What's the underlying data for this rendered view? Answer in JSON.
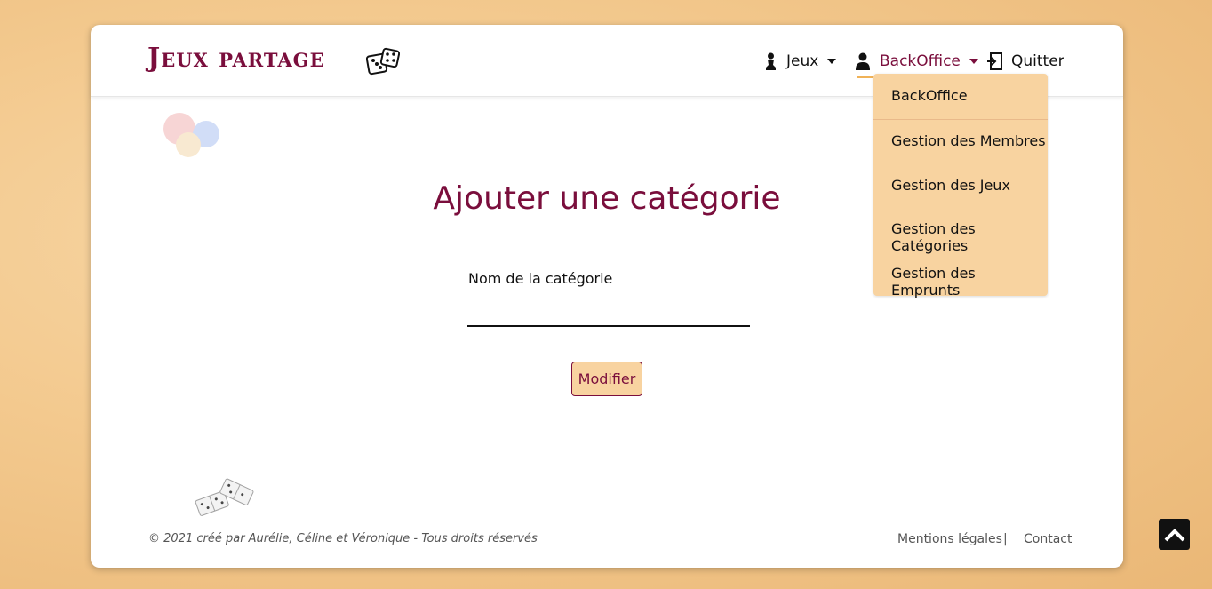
{
  "brand": {
    "name": "Jeux partage"
  },
  "nav": {
    "jeux_label": "Jeux",
    "backoffice_label": "BackOffice",
    "quit_label": "Quitter"
  },
  "dropdown": {
    "items": [
      {
        "label": "BackOffice"
      },
      {
        "label": "Gestion des Membres"
      },
      {
        "label": "Gestion des Jeux"
      },
      {
        "label": "Gestion des Catégories"
      },
      {
        "label": "Gestion des Emprunts"
      }
    ]
  },
  "page": {
    "title": "Ajouter une catégorie",
    "field_label": "Nom de la catégorie",
    "field_value": "",
    "submit_label": "Modifier"
  },
  "footer": {
    "copyright": "© 2021 créé par Aurélie, Céline et Véronique - Tous droits réservés",
    "legal_label": "Mentions légales",
    "separator": "|",
    "contact_label": "Contact"
  },
  "colors": {
    "accent": "#7a0e3c",
    "dropdown_bg": "#f8d3a0",
    "active_underline": "#f0b257"
  },
  "icons": [
    "dice-icon",
    "pawn-icon",
    "user-icon",
    "exit-icon",
    "chevron-up-icon",
    "poker-chips-icon",
    "dominoes-icon"
  ]
}
